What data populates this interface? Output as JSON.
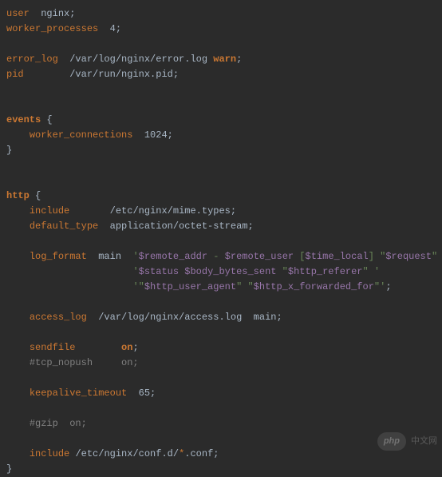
{
  "config": {
    "user_directive": "user",
    "user_value": "nginx",
    "worker_processes_directive": "worker_processes",
    "worker_processes_value": "4",
    "error_log_directive": "error_log",
    "error_log_path": "/var/log/nginx/error.log",
    "error_log_level": "warn",
    "pid_directive": "pid",
    "pid_path": "/var/run/nginx.pid",
    "events_block": "events",
    "worker_connections_directive": "worker_connections",
    "worker_connections_value": "1024",
    "http_block": "http",
    "include_directive": "include",
    "mime_types_path": "/etc/nginx/mime.types",
    "default_type_directive": "default_type",
    "default_type_value": "application/octet-stream",
    "log_format_directive": "log_format",
    "log_format_name": "main",
    "log_line1_pre": "'",
    "log_line1_var1": "$remote_addr",
    "log_line1_mid1": " - ",
    "log_line1_var2": "$remote_user",
    "log_line1_mid2": " [",
    "log_line1_var3": "$time_local",
    "log_line1_mid3": "] \"",
    "log_line1_var4": "$request",
    "log_line1_post": "\" '",
    "log_line2_pre": "'",
    "log_line2_var1": "$status",
    "log_line2_sp1": " ",
    "log_line2_var2": "$body_bytes_sent",
    "log_line2_mid": " \"",
    "log_line2_var3": "$http_referer",
    "log_line2_post": "\" '",
    "log_line3_pre": "'\"",
    "log_line3_var1": "$http_user_agent",
    "log_line3_mid": "\" \"",
    "log_line3_var2": "$http_x_forwarded_for",
    "log_line3_post": "\"'",
    "access_log_directive": "access_log",
    "access_log_path": "/var/log/nginx/access.log",
    "access_log_format": "main",
    "sendfile_directive": "sendfile",
    "sendfile_value": "on",
    "tcp_nopush_comment": "#tcp_nopush     on;",
    "keepalive_directive": "keepalive_timeout",
    "keepalive_value": "65",
    "gzip_comment": "#gzip  on;",
    "include2_directive": "include",
    "include2_path": "/etc/nginx/conf.d/",
    "include2_wildcard": "*",
    "include2_ext": ".conf",
    "semi": ";",
    "brace_open": "{",
    "brace_close": "}"
  },
  "watermark": {
    "logo": "php",
    "text": "中文网"
  }
}
